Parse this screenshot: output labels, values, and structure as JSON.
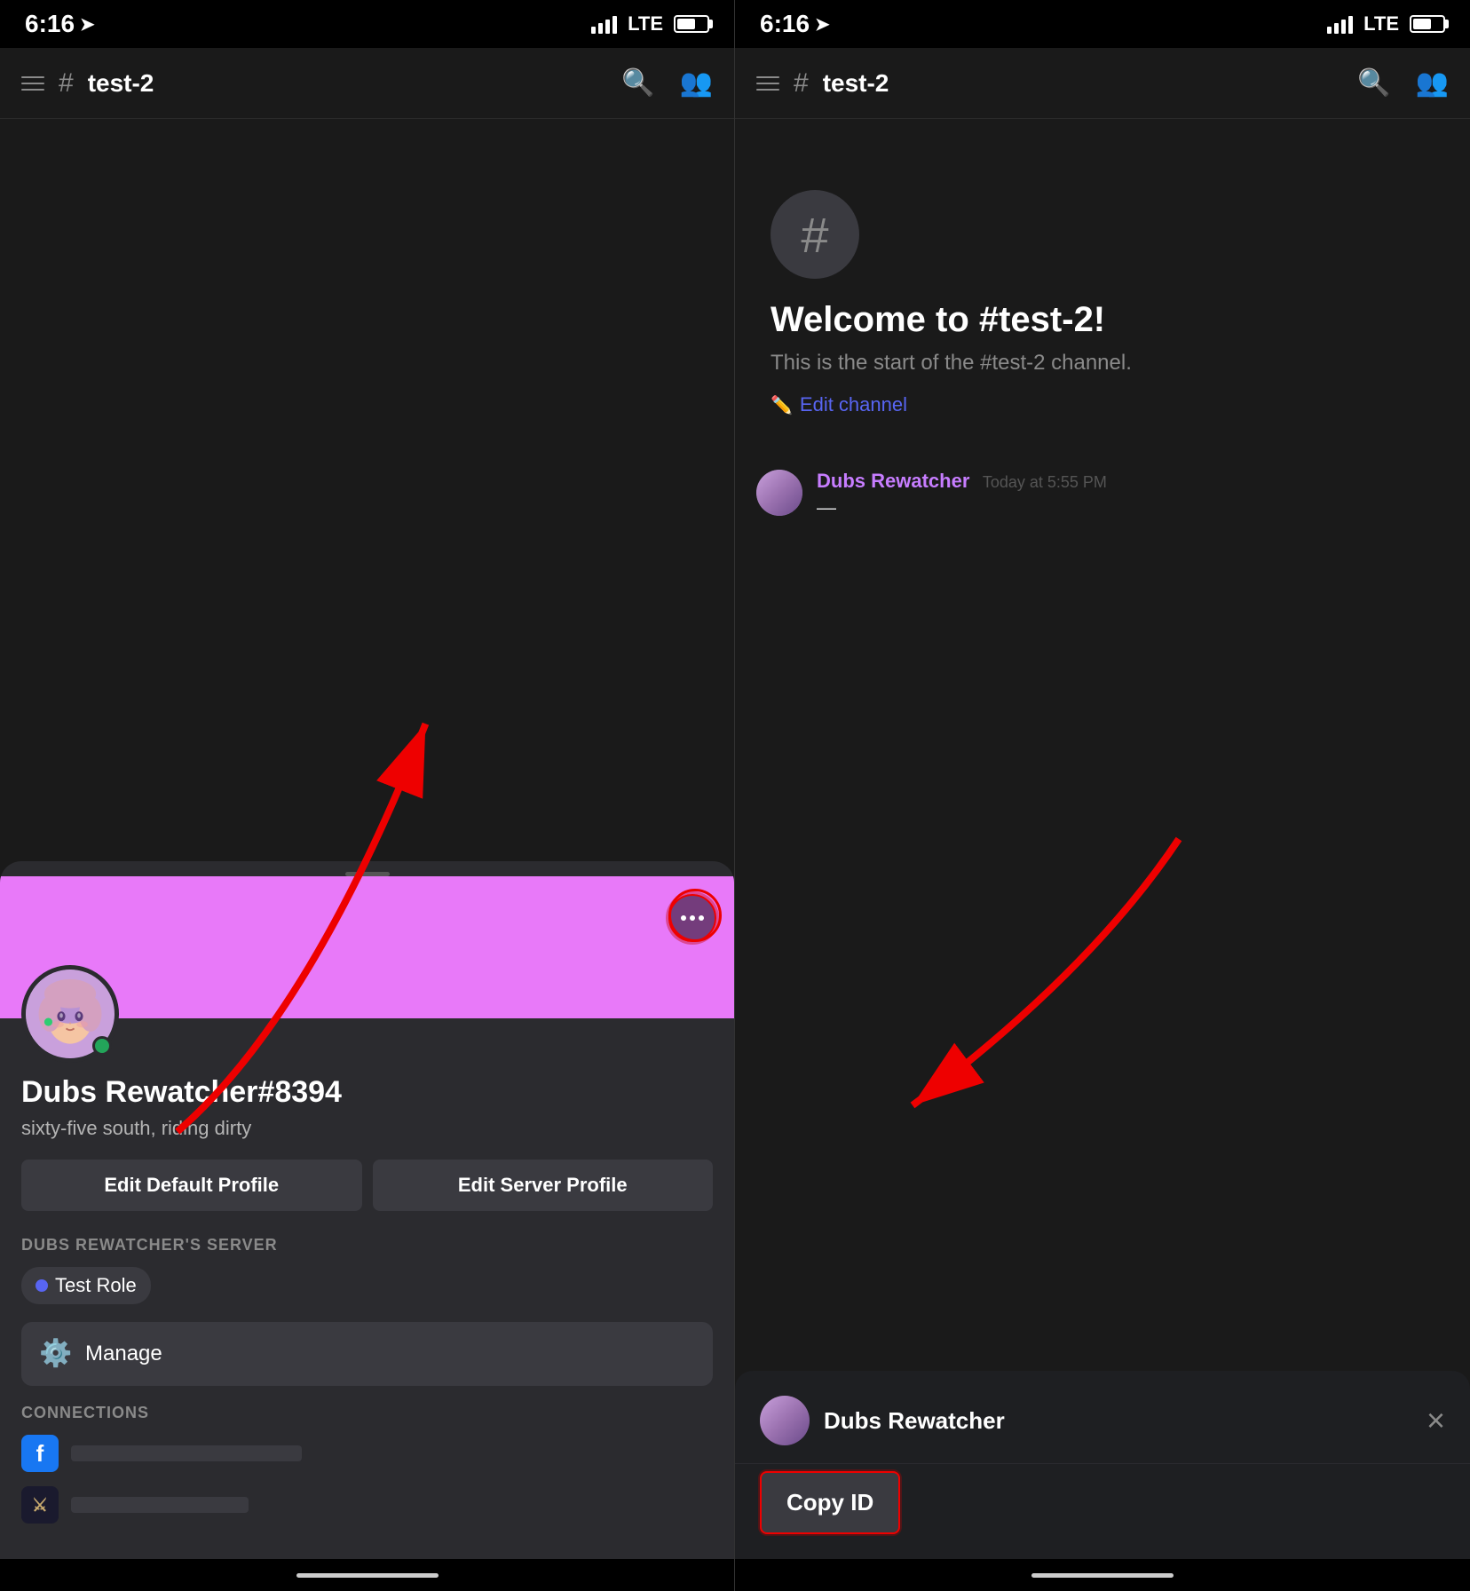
{
  "left_panel": {
    "status_bar": {
      "time": "6:16",
      "signal": "LTE",
      "battery_level": 55
    },
    "nav": {
      "channel": "test-2"
    },
    "profile": {
      "banner_color": "#e879f9",
      "username": "Dubs Rewatcher#8394",
      "discriminator": "#8394",
      "bio": "sixty-five south, riding dirty",
      "edit_default_label": "Edit Default Profile",
      "edit_server_label": "Edit Server Profile",
      "server_section": "DUBS REWATCHER'S SERVER",
      "role_label": "Test Role",
      "manage_label": "Manage",
      "connections_section": "CONNECTIONS"
    },
    "more_button_label": "..."
  },
  "right_panel": {
    "status_bar": {
      "time": "6:16",
      "signal": "LTE",
      "battery_level": 55
    },
    "nav": {
      "channel": "test-2"
    },
    "welcome": {
      "title": "Welcome to #test-2!",
      "subtitle": "This is the start of the #test-2 channel.",
      "edit_channel": "Edit channel"
    },
    "message": {
      "author": "Dubs Rewatcher",
      "time": "Today at 5:55 PM",
      "text": "—"
    },
    "context_menu": {
      "username": "Dubs Rewatcher",
      "copy_id_label": "Copy ID",
      "close_label": "×"
    }
  }
}
